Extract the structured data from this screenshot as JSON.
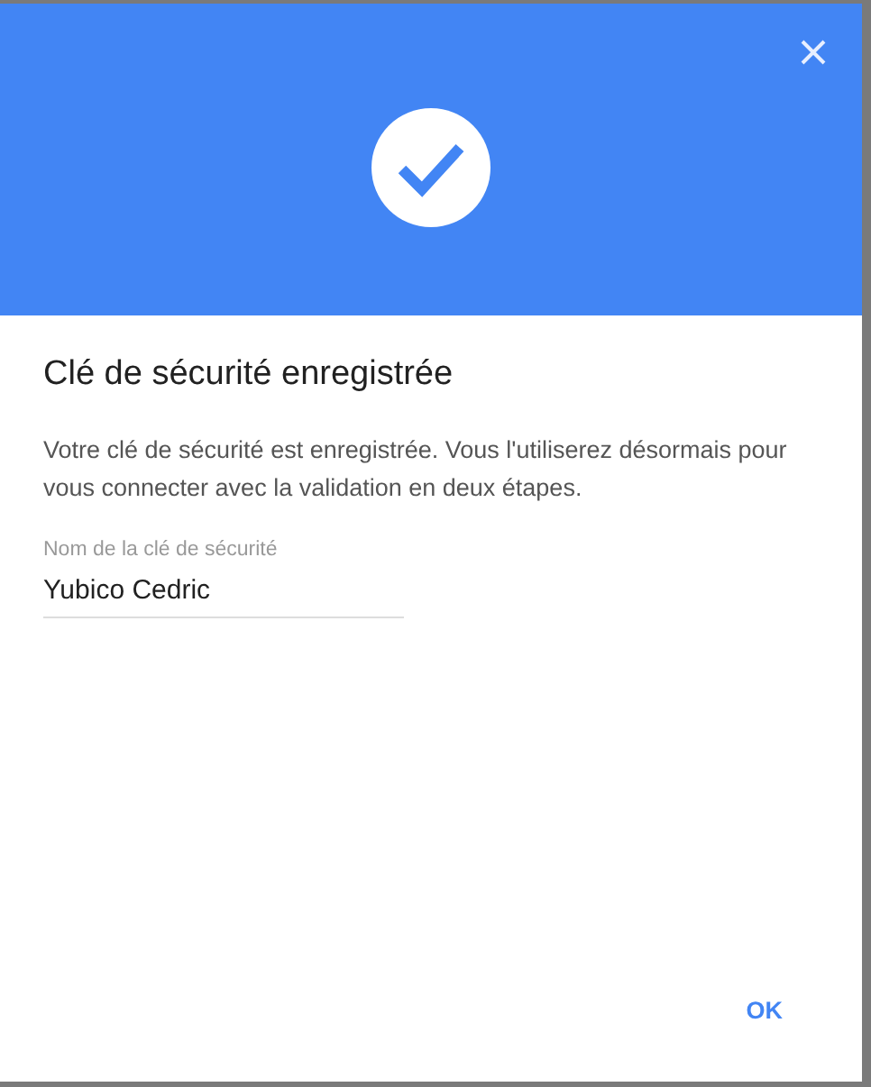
{
  "dialog": {
    "title": "Clé de sécurité enregistrée",
    "message": "Votre clé de sécurité est enregistrée. Vous l'utiliserez désormais pour vous connecter avec la validation en deux étapes.",
    "field": {
      "label": "Nom de la clé de sécurité",
      "value": "Yubico Cedric"
    },
    "buttons": [
      "OK"
    ]
  }
}
